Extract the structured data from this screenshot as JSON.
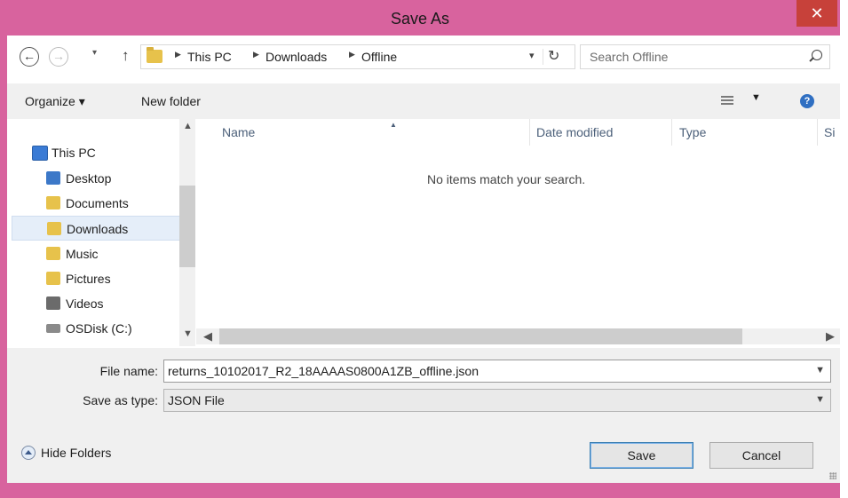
{
  "window": {
    "title": "Save As",
    "close_glyph": "✕"
  },
  "nav_bar": {
    "back_glyph": "←",
    "forward_glyph": "→",
    "recent_glyph": "▾",
    "up_glyph": "↑",
    "breadcrumb": [
      "This PC",
      "Downloads",
      "Offline"
    ],
    "refresh_glyph": "↻",
    "search_placeholder": "Search Offline"
  },
  "toolbar": {
    "organize_label": "Organize ▾",
    "new_folder_label": "New folder"
  },
  "sidebar": {
    "items": [
      {
        "label": "This PC",
        "icon": "computer-icon",
        "color": "#3a7bd5"
      },
      {
        "label": "Desktop",
        "icon": "desktop-folder-icon",
        "color": "#3c78c8"
      },
      {
        "label": "Documents",
        "icon": "documents-folder-icon",
        "color": "#e7c24b"
      },
      {
        "label": "Downloads",
        "icon": "downloads-folder-icon",
        "color": "#e7c24b",
        "selected": true
      },
      {
        "label": "Music",
        "icon": "music-folder-icon",
        "color": "#e7c24b"
      },
      {
        "label": "Pictures",
        "icon": "pictures-folder-icon",
        "color": "#e7c24b"
      },
      {
        "label": "Videos",
        "icon": "videos-folder-icon",
        "color": "#6b6b6b"
      },
      {
        "label": "OSDisk (C:)",
        "icon": "drive-icon",
        "color": "#8a8a8a"
      }
    ]
  },
  "file_list": {
    "columns": [
      "Name",
      "Date modified",
      "Type",
      "Si"
    ],
    "empty_message": "No items match your search."
  },
  "form": {
    "file_name_label": "File name:",
    "file_name_value": "returns_10102017_R2_18AAAAS0800A1ZB_offline.json",
    "save_type_label": "Save as type:",
    "save_type_value": "JSON File"
  },
  "footer": {
    "hide_folders_label": "Hide Folders",
    "save_label": "Save",
    "cancel_label": "Cancel"
  },
  "colors": {
    "frame": "#d8639e",
    "close_button": "#c7413a",
    "selection": "#e5eef9",
    "help": "#2f6fc2"
  }
}
